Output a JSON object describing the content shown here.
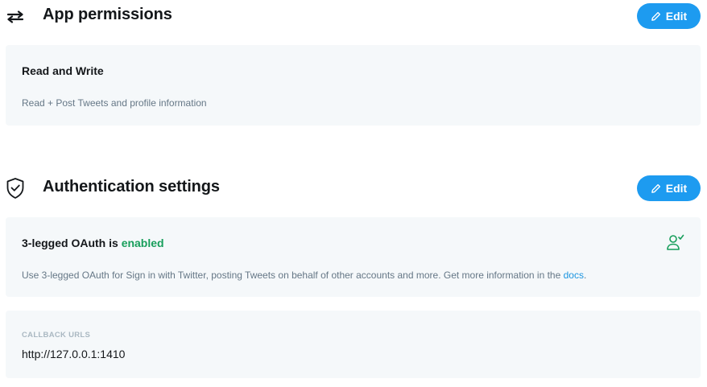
{
  "app_permissions": {
    "title": "App permissions",
    "edit_label": "Edit",
    "icon": "swap-arrows-icon",
    "card": {
      "title": "Read and Write",
      "description": "Read + Post Tweets and profile information"
    }
  },
  "authentication": {
    "title": "Authentication settings",
    "edit_label": "Edit",
    "icon": "shield-check-icon",
    "oauth_card": {
      "title_prefix": "3-legged OAuth is ",
      "status": "enabled",
      "description": "Use 3-legged OAuth for Sign in with Twitter, posting Tweets on behalf of other accounts and more. Get more information in the ",
      "docs_link": "docs",
      "description_suffix": ".",
      "status_icon": "user-check-icon"
    },
    "callback_card": {
      "label": "CALLBACK URLS",
      "value": "http://127.0.0.1:1410"
    }
  },
  "colors": {
    "accent": "#1d9bf0",
    "enabled": "#179e5b",
    "link": "#1b95e0",
    "card_bg": "#f5f8fa"
  }
}
